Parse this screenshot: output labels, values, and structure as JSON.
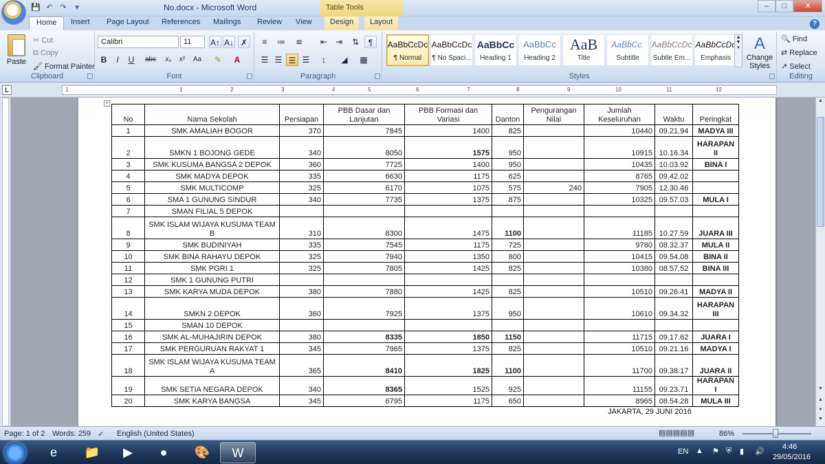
{
  "window": {
    "title": "No.docx - Microsoft Word",
    "context_tab_title": "Table Tools",
    "minimize": "–",
    "maximize": "□",
    "close": "✕"
  },
  "tabs": [
    "Home",
    "Insert",
    "Page Layout",
    "References",
    "Mailings",
    "Review",
    "View",
    "Design",
    "Layout"
  ],
  "ribbon": {
    "clipboard": {
      "label": "Clipboard",
      "paste": "Paste",
      "cut": "Cut",
      "copy": "Copy",
      "format_painter": "Format Painter"
    },
    "font": {
      "label": "Font",
      "font_name": "Calibri",
      "font_size": "11"
    },
    "paragraph": {
      "label": "Paragraph"
    },
    "styles": {
      "label": "Styles",
      "items": [
        {
          "sample": "AaBbCcDc",
          "name": "¶ Normal"
        },
        {
          "sample": "AaBbCcDc",
          "name": "¶ No Spaci..."
        },
        {
          "sample": "AaBbCc",
          "name": "Heading 1"
        },
        {
          "sample": "AaBbCc",
          "name": "Heading 2"
        },
        {
          "sample": "AaB",
          "name": "Title"
        },
        {
          "sample": "AaBbCc.",
          "name": "Subtitle"
        },
        {
          "sample": "AaBbCcDc",
          "name": "Subtle Em..."
        },
        {
          "sample": "AaBbCcDc",
          "name": "Emphasis"
        }
      ],
      "change_styles": "Change Styles"
    },
    "editing": {
      "label": "Editing",
      "find": "Find",
      "replace": "Replace",
      "select": "Select"
    }
  },
  "ruler_numbers": [
    "1",
    "1",
    "2",
    "3",
    "4",
    "5",
    "6",
    "7",
    "8",
    "9",
    "10",
    "11",
    "12"
  ],
  "table": {
    "headers": [
      "No",
      "Nama Sekolah",
      "Persiapan",
      "PBB Dasar dan Lanjutan",
      "PBB Formasi dan Variasi",
      "Danton",
      "Pengurangan Nilai",
      "Jumlah Keseluruhan",
      "Waktu",
      "Peringkat"
    ],
    "rows": [
      [
        "1",
        "SMK AMALIAH BOGOR",
        "370",
        "7845",
        "1400",
        "825",
        "",
        "10440",
        "09.21.94",
        "MADYA III"
      ],
      [
        "2",
        "SMKN 1 BOJONG GEDE",
        "340",
        "8050",
        "1575",
        "950",
        "",
        "10915",
        "10.16.34",
        "HARAPAN II"
      ],
      [
        "3",
        "SMK KUSUMA BANGSA 2 DEPOK",
        "360",
        "7725",
        "1400",
        "950",
        "",
        "10435",
        "10.03.92",
        "BINA I"
      ],
      [
        "4",
        "SMK MADYA DEPOK",
        "335",
        "6630",
        "1175",
        "625",
        "",
        "8765",
        "09.42.02",
        ""
      ],
      [
        "5",
        "SMK MULTICOMP",
        "325",
        "6170",
        "1075",
        "575",
        "240",
        "7905",
        "12.30.46",
        ""
      ],
      [
        "6",
        "SMA 1 GUNUNG SINDUR",
        "340",
        "7735",
        "1375",
        "875",
        "",
        "10325",
        "09.57.03",
        "MULA I"
      ],
      [
        "7",
        "SMAN FILIAL 5 DEPOK",
        "",
        "",
        "",
        "",
        "",
        "",
        "",
        ""
      ],
      [
        "8",
        "SMK ISLAM WIJAYA KUSUMA TEAM B",
        "310",
        "8300",
        "1475",
        "1100",
        "",
        "11185",
        "10.27.59",
        "JUARA III"
      ],
      [
        "9",
        "SMK BUDINIYAH",
        "335",
        "7545",
        "1175",
        "725",
        "",
        "9780",
        "08.32.37",
        "MULA II"
      ],
      [
        "10",
        "SMK BINA RAHAYU DEPOK",
        "325",
        "7940",
        "1350",
        "800",
        "",
        "10415",
        "09.54.08",
        "BINA II"
      ],
      [
        "11",
        "SMK PGRI 1",
        "325",
        "7805",
        "1425",
        "825",
        "",
        "10380",
        "08.57.52",
        "BINA III"
      ],
      [
        "12",
        "SMK 1 GUNUNG PUTRI",
        "",
        "",
        "",
        "",
        "",
        "",
        "",
        ""
      ],
      [
        "13",
        "SMK KARYA MUDA DEPOK",
        "380",
        "7880",
        "1425",
        "825",
        "",
        "10510",
        "09.26.41",
        "MADYA II"
      ],
      [
        "14",
        "SMKN 2 DEPOK",
        "360",
        "7925",
        "1375",
        "950",
        "",
        "10610",
        "09.34.32",
        "HARAPAN III"
      ],
      [
        "15",
        "SMAN 10 DEPOK",
        "",
        "",
        "",
        "",
        "",
        "",
        "",
        ""
      ],
      [
        "16",
        "SMK AL-MUHAJIRIN DEPOK",
        "380",
        "8335",
        "1850",
        "1150",
        "",
        "11715",
        "09.17.62",
        "JUARA I"
      ],
      [
        "17",
        "SMK PERGURUAN RAKYAT 1",
        "345",
        "7965",
        "1375",
        "825",
        "",
        "10510",
        "09.21.16",
        "MADYA I"
      ],
      [
        "18",
        "SMK ISLAM WIJAYA KUSUMA TEAM A",
        "365",
        "8410",
        "1825",
        "1100",
        "",
        "11700",
        "09.38.17",
        "JUARA II"
      ],
      [
        "19",
        "SMK SETIA NEGARA DEPOK",
        "340",
        "8365",
        "1525",
        "925",
        "",
        "11155",
        "09.23.71",
        "HARAPAN I"
      ],
      [
        "20",
        "SMK KARYA BANGSA",
        "345",
        "6795",
        "1175",
        "650",
        "",
        "8965",
        "08.54.28",
        "MULA III"
      ]
    ],
    "footer_note": "JAKARTA, 29 JUNI 2016"
  },
  "status": {
    "page": "Page: 1 of 2",
    "words": "Words: 259",
    "language": "English (United States)",
    "zoom": "86%"
  },
  "tray": {
    "lang": "EN",
    "time": "4:46",
    "date": "29/05/2016"
  }
}
